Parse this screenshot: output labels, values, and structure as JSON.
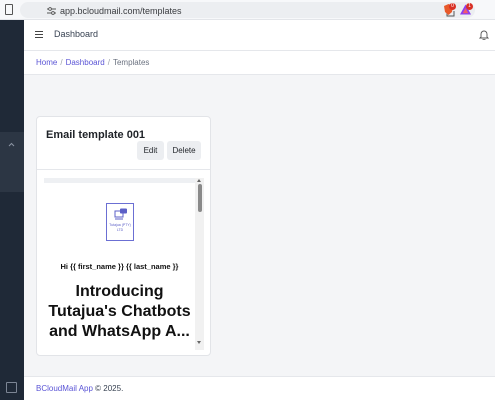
{
  "browser": {
    "url": "app.bcloudmail.com/templates",
    "extension_badges": [
      "0",
      "1"
    ]
  },
  "header": {
    "title": "Dashboard"
  },
  "breadcrumb": {
    "home": "Home",
    "separator": "/",
    "dashboard": "Dashboard",
    "current": "Templates"
  },
  "card": {
    "title": "Email template 001",
    "edit_label": "Edit",
    "delete_label": "Delete",
    "preview": {
      "logo_text": "Tutajua (PTY) LTD",
      "greeting": "Hi {{ first_name }} {{ last_name }}",
      "headline": "Introducing Tutajua's Chatbots and WhatsApp A..."
    }
  },
  "footer": {
    "app_name": "BCloudMail App",
    "copyright": "© 2025."
  },
  "colors": {
    "accent": "#5b55d6",
    "sidebar": "#1f2937"
  },
  "icons": {
    "bookmark": "bookmark-icon",
    "site_settings": "tune-icon",
    "share": "share-icon",
    "menu": "hamburger-icon",
    "notifications": "bell-icon"
  }
}
